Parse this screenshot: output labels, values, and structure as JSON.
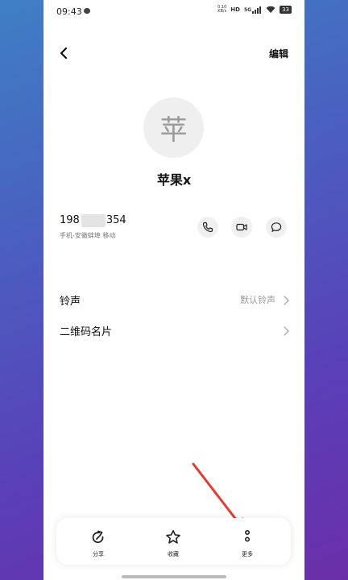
{
  "status": {
    "time": "09:43",
    "speed_top": "0.10",
    "speed_bottom": "KB/s",
    "hd": "HD",
    "signal": "5G",
    "battery": "33"
  },
  "header": {
    "edit_label": "编辑"
  },
  "contact": {
    "avatar_char": "苹",
    "name": "苹果x",
    "phone_number": "198      27 6354",
    "phone_sub": "手机-安徽蚌埠 移动"
  },
  "settings": {
    "ringtone_label": "铃声",
    "ringtone_value": "默认铃声",
    "qrcode_label": "二维码名片"
  },
  "bottom_bar": {
    "share_label": "分享",
    "favorite_label": "收藏",
    "more_label": "更多"
  },
  "colors": {
    "annotation_arrow": "#e63b2e"
  }
}
